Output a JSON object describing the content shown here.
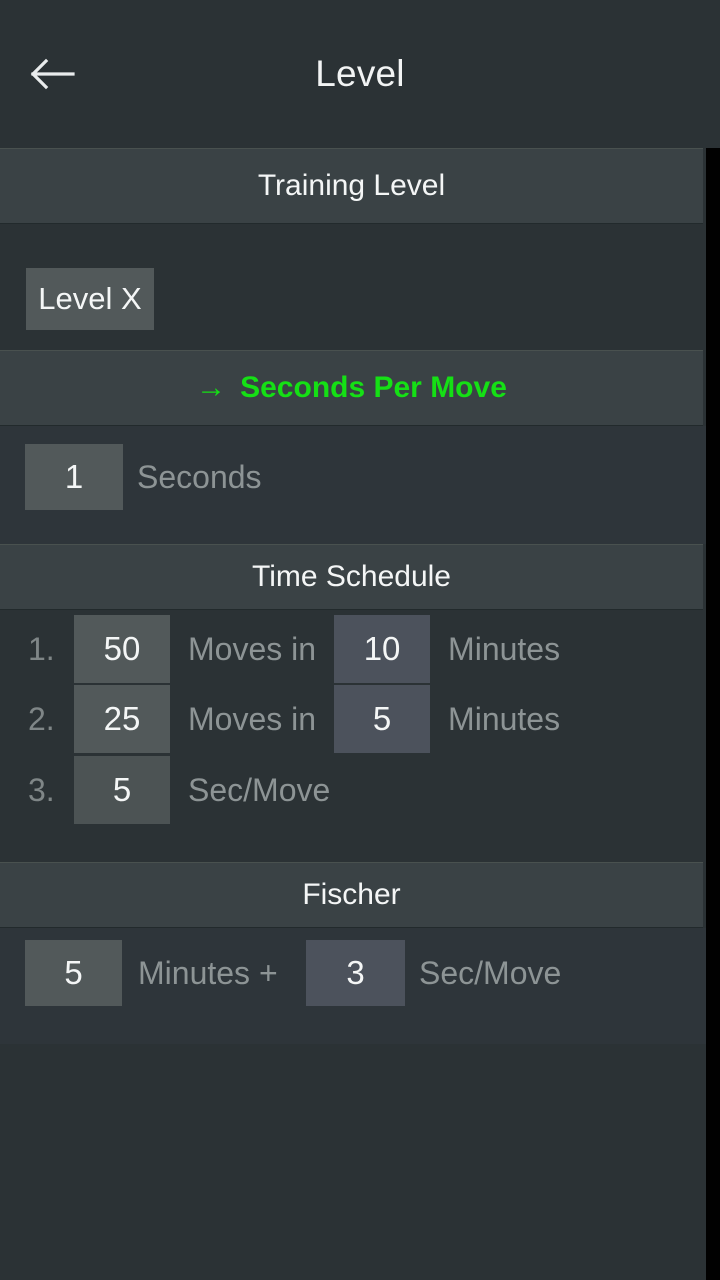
{
  "titlebar": {
    "back_icon": "arrow-left-icon",
    "title": "Level"
  },
  "colors": {
    "screen_bg": "#2b3235",
    "section_header_bg": "#3a4245",
    "accent_green": "#15e015",
    "chip_gray": "#52595a",
    "chip_blue": "#4c525c",
    "label_gray": "#8d9495",
    "text_white": "#f4f6f6",
    "gutter_black": "#010101"
  },
  "sections": {
    "training_level": {
      "header": "Training Level",
      "level_button": "Level X"
    },
    "seconds_per_move": {
      "arrow_glyph": "→",
      "header": "Seconds Per Move",
      "active": true,
      "value": "1",
      "unit_label": "Seconds"
    },
    "time_schedule": {
      "header": "Time Schedule",
      "rows": [
        {
          "number": "1.",
          "moves": "50",
          "mid_label": "Moves in",
          "minutes": "10",
          "end_label": "Minutes"
        },
        {
          "number": "2.",
          "moves": "25",
          "mid_label": "Moves in",
          "minutes": "5",
          "end_label": "Minutes"
        },
        {
          "number": "3.",
          "moves": "5",
          "mid_label": "Sec/Move",
          "minutes": "",
          "end_label": ""
        }
      ]
    },
    "fischer": {
      "header": "Fischer",
      "minutes": "5",
      "minutes_label": "Minutes +",
      "seconds": "3",
      "seconds_label": "Sec/Move"
    }
  }
}
